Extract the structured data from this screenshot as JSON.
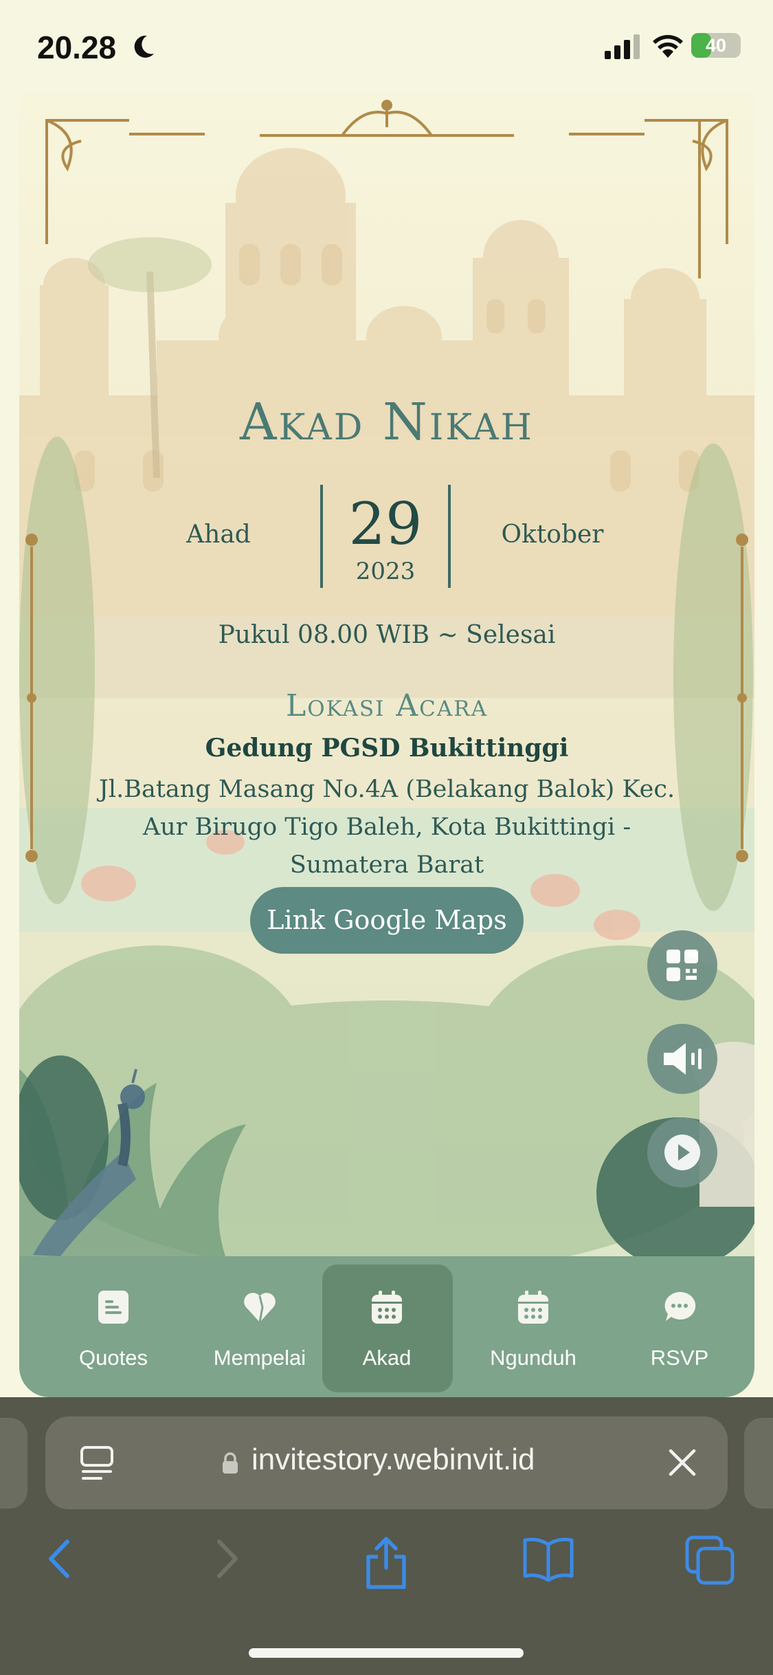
{
  "status_bar": {
    "time": "20.28",
    "battery": "40",
    "battery_level": 0.4
  },
  "invitation": {
    "title": "Akad Nikah",
    "day": "Ahad",
    "date": "29",
    "year": "2023",
    "month": "Oktober",
    "time": "Pukul 08.00 WIB ~ Selesai",
    "location_heading": "Lokasi Acara",
    "venue": "Gedung PGSD Bukittinggi",
    "address": "Jl.Batang Masang No.4A (Belakang Balok) Kec. Aur Birugo Tigo Baleh, Kota Bukittingi - Sumatera Barat",
    "maps_button": "Link Google Maps"
  },
  "floating_buttons": [
    {
      "icon": "qr-code-icon"
    },
    {
      "icon": "speaker-icon"
    },
    {
      "icon": "play-icon"
    }
  ],
  "nav": {
    "active_index": 2,
    "items": [
      {
        "label": "Quotes",
        "icon": "quotes-icon"
      },
      {
        "label": "Mempelai",
        "icon": "heart-icon"
      },
      {
        "label": "Akad",
        "icon": "calendar-icon"
      },
      {
        "label": "Ngunduh",
        "icon": "calendar-icon"
      },
      {
        "label": "RSVP",
        "icon": "chat-icon"
      }
    ]
  },
  "browser": {
    "url": "invitestory.webinvit.id"
  },
  "colors": {
    "accent": "#5d8a82",
    "nav_background": "#7ea48b",
    "nav_active": "#668a6f",
    "gold": "#b08a4a",
    "browser_blue": "#3d8ae6"
  }
}
